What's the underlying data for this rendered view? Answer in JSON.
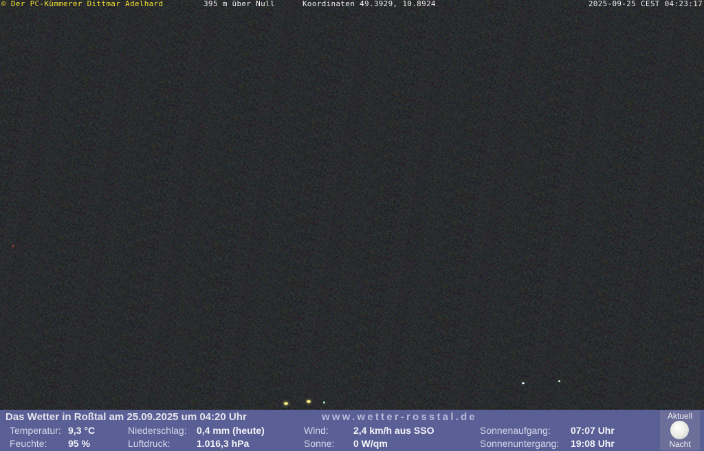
{
  "overlay": {
    "copyright_symbol": "©",
    "owner": "Der PC-Kümmerer Dittmar Adelhard",
    "altitude": "395 m über Null",
    "coordinates": "Koordinaten 49.3929, 10.8924",
    "timestamp": "2025-09-25 CEST 04:23:17"
  },
  "weather": {
    "headline": "Das Wetter in Roßtal am 25.09.2025 um 04:20 Uhr",
    "website": "www.wetter-rosstal.de",
    "temperature_label": "Temperatur:",
    "temperature_value": "9,3 °C",
    "humidity_label": "Feuchte:",
    "humidity_value": "95 %",
    "precip_label": "Niederschlag:",
    "precip_value": "0,4 mm (heute)",
    "pressure_label": "Luftdruck:",
    "pressure_value": "1.016,3 hPa",
    "wind_label": "Wind:",
    "wind_value": "2,4 km/h aus SSO",
    "sun_label": "Sonne:",
    "sun_value": "0 W/qm",
    "sunrise_label": "Sonnenaufgang:",
    "sunrise_value": "07:07 Uhr",
    "sunset_label": "Sonnenuntergang:",
    "sunset_value": "19:08 Uhr"
  },
  "moon": {
    "title": "Aktuell",
    "status": "Nacht",
    "icon": "full-moon-icon"
  },
  "colors": {
    "panel_bg": "#5a5f96",
    "owner_text": "#f0e030",
    "overlay_text": "#f0f0f0"
  }
}
